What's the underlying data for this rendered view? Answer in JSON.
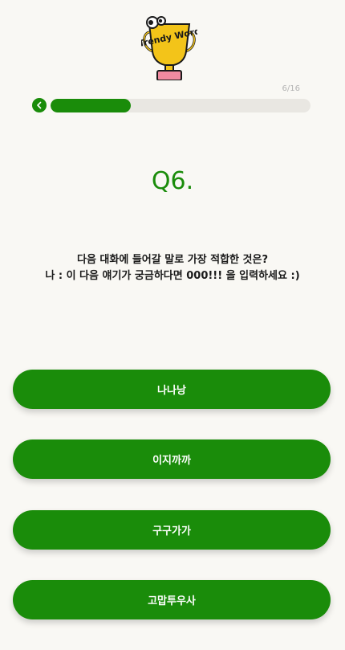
{
  "logo": {
    "icon": "trendy-word-trophy-logo",
    "text": "Trendy Word"
  },
  "progress": {
    "label": "6/16",
    "fraction": 0.31,
    "color": "#1a8c0a"
  },
  "nav": {
    "back_icon": "chevron-left-icon"
  },
  "quiz": {
    "number": "Q6.",
    "question_line1": "다음 대화에 들어갈 말로 가장 적합한 것은?",
    "question_line2": "나 : 이 다음 얘기가 궁금하다면 000!!! 을 입력하세요 :)"
  },
  "options": [
    {
      "label": "나나낭"
    },
    {
      "label": "이지까까"
    },
    {
      "label": "구구가가"
    },
    {
      "label": "고맙투우사"
    }
  ],
  "colors": {
    "accent": "#1a8c0a",
    "background": "#f9f8f4",
    "track": "#e9e7e2"
  }
}
